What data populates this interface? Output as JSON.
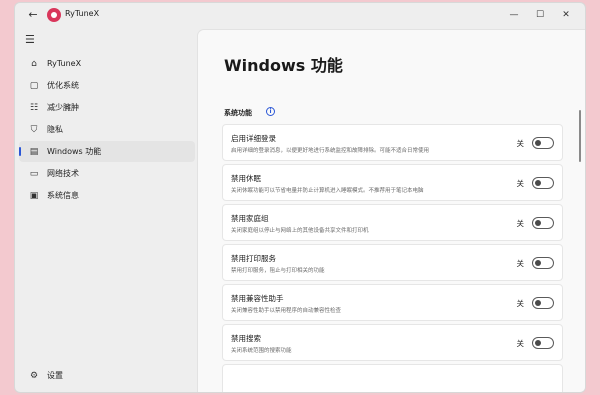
{
  "window": {
    "title": "RyTuneX",
    "back_glyph": "←",
    "min_glyph": "—",
    "max_glyph": "☐",
    "close_glyph": "✕",
    "logo_icon": "rytunex-logo-icon",
    "accent_color": "#2b57d6",
    "logo_color": "#d9365b"
  },
  "sidebar": {
    "menu_glyph": "☰",
    "items": [
      {
        "label": "RyTuneX",
        "icon": "home-icon",
        "glyph": "⌂"
      },
      {
        "label": "优化系统",
        "icon": "optimize-icon",
        "glyph": "▢"
      },
      {
        "label": "减少臃肿",
        "icon": "debloat-icon",
        "glyph": "☷"
      },
      {
        "label": "隐私",
        "icon": "shield-icon",
        "glyph": "⛉"
      },
      {
        "label": "Windows 功能",
        "icon": "windows-features-icon",
        "glyph": "▤"
      },
      {
        "label": "网络技术",
        "icon": "network-icon",
        "glyph": "▭"
      },
      {
        "label": "系统信息",
        "icon": "system-info-icon",
        "glyph": "▣"
      }
    ],
    "active_index": 4,
    "settings": {
      "label": "设置",
      "icon": "gear-icon",
      "glyph": "⚙"
    }
  },
  "main": {
    "title": "Windows 功能",
    "section_label": "系统功能",
    "info_glyph": "i",
    "features": [
      {
        "title": "启用详细登录",
        "desc": "启用详细的登录消息，以便更好地进行系统监控和故障排除。可能不适合日常使用",
        "state": "关"
      },
      {
        "title": "禁用休眠",
        "desc": "关闭休眠功能可以节省电量并防止计算机进入睡眠模式。不推荐用于笔记本电脑",
        "state": "关"
      },
      {
        "title": "禁用家庭组",
        "desc": "关闭家庭组以停止与网络上的其他设备共享文件和打印机",
        "state": "关"
      },
      {
        "title": "禁用打印服务",
        "desc": "禁用打印服务，阻止与打印相关的功能",
        "state": "关"
      },
      {
        "title": "禁用兼容性助手",
        "desc": "关闭兼容性助手以禁用程序的自动兼容性检查",
        "state": "关"
      },
      {
        "title": "禁用搜索",
        "desc": "关闭系统范围的搜索功能",
        "state": "关"
      }
    ]
  }
}
